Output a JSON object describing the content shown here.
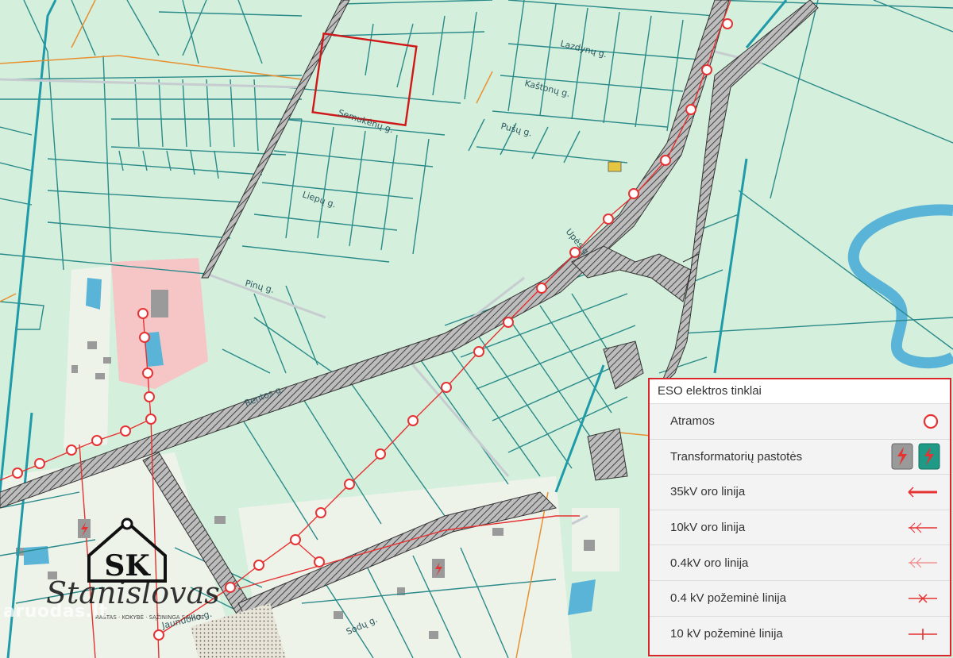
{
  "streets": {
    "lazdynu": "Lazdynų g.",
    "kastonu": "Kaštonų g.",
    "semukeniu": "Semukėnų g.",
    "pusu": "Pušų g.",
    "liepu": "Liepų g.",
    "upes": "Upės g.",
    "pinu": "Pinų g.",
    "rentos": "Rentos g.",
    "jaunuolio": "Jaunuolio g.",
    "sodu": "Sodų g."
  },
  "legend": {
    "title": "ESO elektros tinklai",
    "items": [
      {
        "label": "Atramos",
        "icon": "circle-support-icon"
      },
      {
        "label": "Transformatorių pastotės",
        "icon": "substation-icon"
      },
      {
        "label": "35kV oro linija",
        "icon": "line-35kv-icon"
      },
      {
        "label": "10kV oro linija",
        "icon": "line-10kv-icon"
      },
      {
        "label": "0.4kV oro linija",
        "icon": "line-04kv-icon"
      },
      {
        "label": "0.4 kV požeminė linija",
        "icon": "underground-04kv-icon"
      },
      {
        "label": "10 kV požeminė linija",
        "icon": "underground-10kv-icon"
      }
    ]
  },
  "logo": {
    "initials": "SK",
    "signature": "Stanislovas",
    "tagline": "RAŠTAS · KOKYBĖ · SĄŽININGA SAVAITĖ"
  },
  "watermark": "aruodas.lt",
  "colors": {
    "land": "#d4efdc",
    "parcel_line": "#2a8a8a",
    "road_hatch": "#4a4a4a",
    "power_line": "#e53232",
    "river": "#5ab4d8",
    "highlight_parcel": "#d01818",
    "pink_zone": "#f6c6c6"
  }
}
